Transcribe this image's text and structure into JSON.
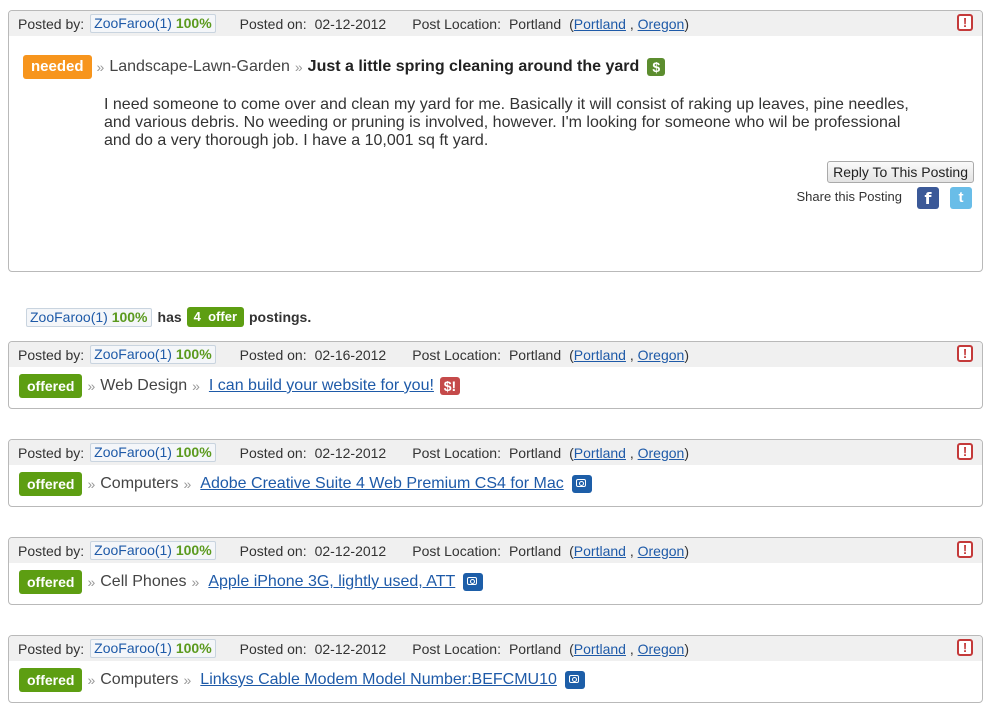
{
  "meta_labels": {
    "posted_by": "Posted by:",
    "posted_on": "Posted on:",
    "post_location": "Post Location:",
    "sep": ","
  },
  "main_post": {
    "user": "ZooFaroo(1)",
    "rating": "100%",
    "date": "02-12-2012",
    "location": "Portland",
    "city_link": "Portland",
    "state_link": "Oregon",
    "tag": "needed",
    "category": "Landscape-Lawn-Garden",
    "title": "Just a little spring cleaning around the yard",
    "price_icon": "$",
    "body": "I need someone to come over and clean my yard for me. Basically it will consist of raking up leaves, pine needles, and various debris. No weeding or pruning is involved, however. I'm looking for someone who wil be professional and do a very thorough job. I have a 10,001 sq ft yard.",
    "reply_label": "Reply To This Posting",
    "share_label": "Share this Posting",
    "facebook_icon": "f",
    "twitter_icon": "t"
  },
  "summary": {
    "user": "ZooFaroo(1)",
    "rating": "100%",
    "has": "has",
    "count": "4",
    "count_label": "offer",
    "postings": "postings."
  },
  "offers": [
    {
      "user": "ZooFaroo(1)",
      "rating": "100%",
      "date": "02-16-2012",
      "location": "Portland",
      "city_link": "Portland",
      "state_link": "Oregon",
      "tag": "offered",
      "category": "Web Design",
      "title": " I can build your website for you!",
      "icon": "money-red-icon",
      "icon_text": "$!"
    },
    {
      "user": "ZooFaroo(1)",
      "rating": "100%",
      "date": "02-12-2012",
      "location": "Portland",
      "city_link": "Portland",
      "state_link": "Oregon",
      "tag": "offered",
      "category": "Computers",
      "title": " Adobe Creative Suite 4 Web Premium CS4 for Mac",
      "icon": "camera-icon"
    },
    {
      "user": "ZooFaroo(1)",
      "rating": "100%",
      "date": "02-12-2012",
      "location": "Portland",
      "city_link": "Portland",
      "state_link": "Oregon",
      "tag": "offered",
      "category": "Cell Phones",
      "title": " Apple iPhone 3G, lightly used, ATT",
      "icon": "camera-icon"
    },
    {
      "user": "ZooFaroo(1)",
      "rating": "100%",
      "date": "02-12-2012",
      "location": "Portland",
      "city_link": "Portland",
      "state_link": "Oregon",
      "tag": "offered",
      "category": "Computers",
      "title": " Linksys Cable Modem Model Number:BEFCMU10",
      "icon": "camera-icon"
    }
  ],
  "flag_icon": "!",
  "breadcrumb_sep": "»",
  "colors": {
    "needed": "#f7951d",
    "offered": "#5d9e12",
    "link": "#1e5aa8",
    "flag": "#c43a3a"
  }
}
